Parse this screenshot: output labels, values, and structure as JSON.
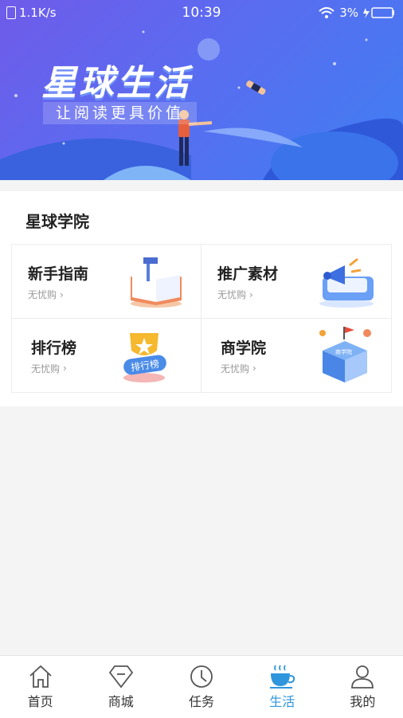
{
  "status_bar": {
    "speed": "1.1K/s",
    "time": "10:39",
    "battery": "3%"
  },
  "banner": {
    "title": "星球生活",
    "subtitle": "让阅读更具价值"
  },
  "section": {
    "title": "星球学院"
  },
  "cards": [
    {
      "title": "新手指南",
      "sub": "无忧购",
      "icon": "book-icon"
    },
    {
      "title": "推广素材",
      "sub": "无忧购",
      "icon": "megaphone-icon"
    },
    {
      "title": "排行榜",
      "sub": "无忧购",
      "icon": "trophy-icon",
      "badge": "排行榜"
    },
    {
      "title": "商学院",
      "sub": "无忧购",
      "icon": "school-icon",
      "badge": "商学院"
    }
  ],
  "tabs": [
    {
      "label": "首页",
      "icon": "home-icon"
    },
    {
      "label": "商城",
      "icon": "diamond-icon"
    },
    {
      "label": "任务",
      "icon": "clock-icon"
    },
    {
      "label": "生活",
      "icon": "coffee-icon",
      "active": true
    },
    {
      "label": "我的",
      "icon": "user-icon"
    }
  ],
  "colors": {
    "accent": "#2f95dc",
    "banner_start": "#6f5bea",
    "banner_end": "#3f7ff2"
  }
}
